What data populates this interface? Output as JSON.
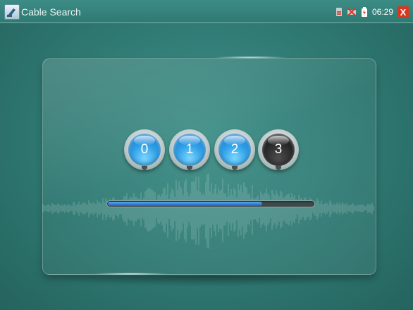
{
  "app": {
    "title": "Cable Search",
    "icon": "cable-tester-icon"
  },
  "status_bar": {
    "icons": [
      "sd-card-icon",
      "network-disconnected-icon",
      "battery-icon"
    ],
    "time": "06:29",
    "close_label": "X"
  },
  "digits": [
    {
      "label": "0",
      "state": "inactive"
    },
    {
      "label": "1",
      "state": "inactive"
    },
    {
      "label": "2",
      "state": "inactive"
    },
    {
      "label": "3",
      "state": "active"
    }
  ],
  "progress": {
    "value_fraction": 0.75
  },
  "colors": {
    "background": "#2f7872",
    "digit_blue": "#2f9fe6",
    "digit_active": "#262626",
    "progress_blue": "#1d5fb4",
    "close_red": "#d8361e"
  }
}
